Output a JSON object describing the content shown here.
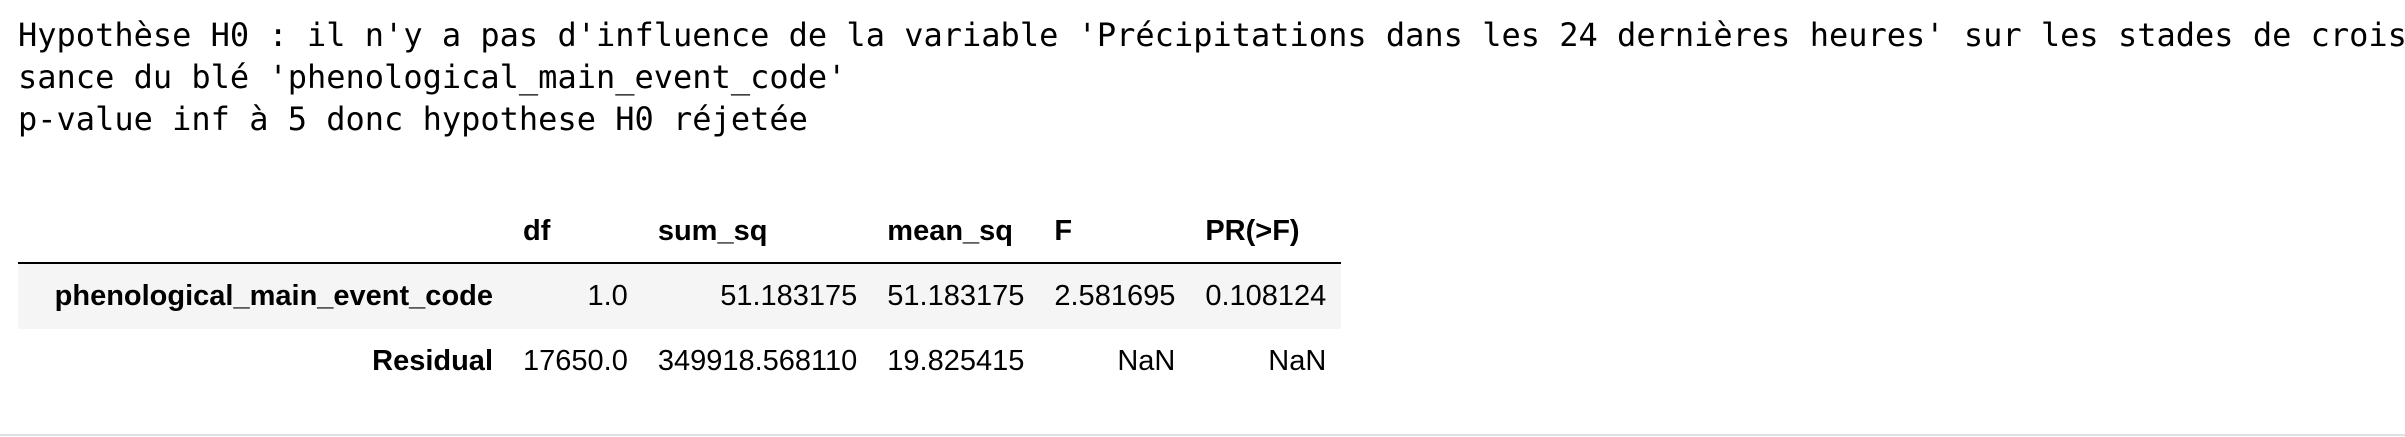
{
  "stream_output": {
    "lines": [
      "Hypothèse H0 : il n'y a pas d'influence de la variable 'Précipitations dans les 24 dernières heures' sur les stades de crois",
      "sance du blé 'phenological_main_event_code'",
      "p-value inf à 5 donc hypothese H0 réjetée"
    ]
  },
  "anova_table": {
    "columns": [
      "df",
      "sum_sq",
      "mean_sq",
      "F",
      "PR(>F)"
    ],
    "rows": [
      {
        "index": "phenological_main_event_code",
        "values": [
          "1.0",
          "51.183175",
          "51.183175",
          "2.581695",
          "0.108124"
        ]
      },
      {
        "index": "Residual",
        "values": [
          "17650.0",
          "349918.568110",
          "19.825415",
          "NaN",
          "NaN"
        ]
      }
    ]
  },
  "colors": {
    "stripe": "#f5f5f5",
    "header_rule": "#000000",
    "divider": "#e0e0e0"
  }
}
